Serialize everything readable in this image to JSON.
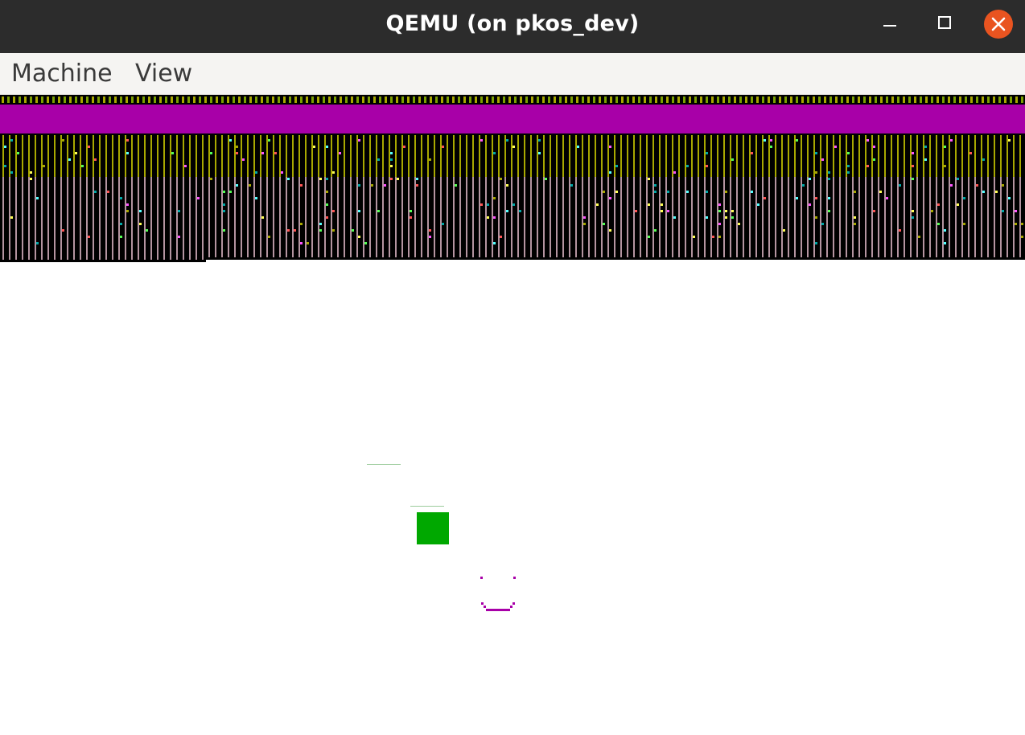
{
  "window": {
    "title": "QEMU (on pkos_dev)",
    "controls": {
      "minimize_icon": "minimize-icon",
      "maximize_icon": "maximize-icon",
      "close_icon": "close-icon",
      "close_color": "#e95420"
    }
  },
  "menubar": {
    "items": [
      {
        "label": "Machine"
      },
      {
        "label": "View"
      }
    ]
  },
  "display": {
    "colors": {
      "background": "#ffffff",
      "glitch_black": "#000000",
      "glitch_olive": "#a8a800",
      "glitch_pink": "#b494a0",
      "magenta_band": "#a800a8",
      "green_square": "#00a800",
      "smiley": "#a800a8"
    }
  }
}
